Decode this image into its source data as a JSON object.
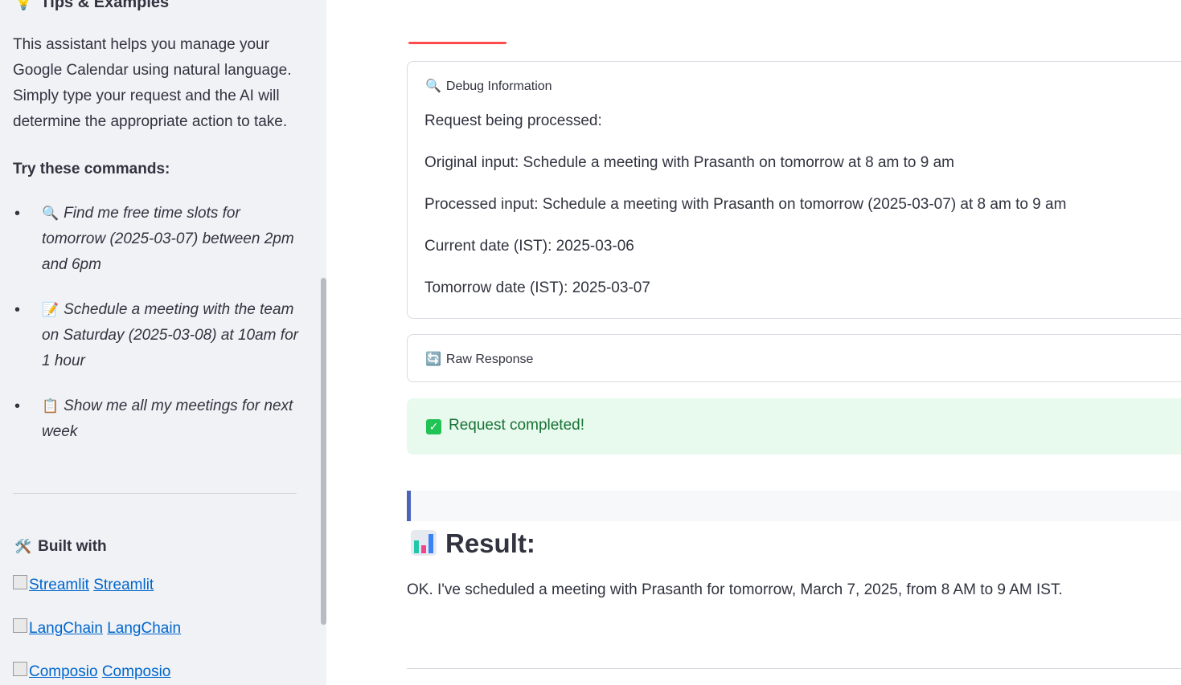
{
  "sidebar": {
    "heading_icon": "💡",
    "heading": "Tips & Examples",
    "intro": "This assistant helps you manage your Google Calendar using natural language. Simply type your request and the AI will determine the appropriate action to take.",
    "try_label": "Try these commands:",
    "commands": [
      {
        "icon": "🔍",
        "text": "Find me free time slots for tomorrow (2025-03-07) between 2pm and 6pm"
      },
      {
        "icon": "📝",
        "text": "Schedule a meeting with the team on Saturday (2025-03-08) at 10am for 1 hour"
      },
      {
        "icon": "📋",
        "text": "Show me all my meetings for next week"
      }
    ],
    "built_icon": "🛠️",
    "built_label": "Built with",
    "links": [
      {
        "img_alt": "Streamlit",
        "label": "Streamlit"
      },
      {
        "img_alt": "LangChain",
        "label": "LangChain"
      },
      {
        "img_alt": "Composio",
        "label": "Composio"
      }
    ]
  },
  "main": {
    "debug": {
      "icon": "🔍",
      "title": "Debug Information",
      "lines": [
        "Request being processed:",
        "Original input: Schedule a meeting with Prasanth on tomorrow at 8 am to 9 am",
        "Processed input: Schedule a meeting with Prasanth on tomorrow (2025-03-07) at 8 am to 9 am",
        "Current date (IST): 2025-03-06",
        "Tomorrow date (IST): 2025-03-07"
      ]
    },
    "raw": {
      "icon": "🔄",
      "title": "Raw Response"
    },
    "success": {
      "text": "Request completed!",
      "color": "#21c354"
    },
    "result_title": "Result:",
    "result_text": "OK. I've scheduled a meeting with Prasanth for tomorrow, March 7, 2025, from 8 AM to 9 AM IST."
  }
}
